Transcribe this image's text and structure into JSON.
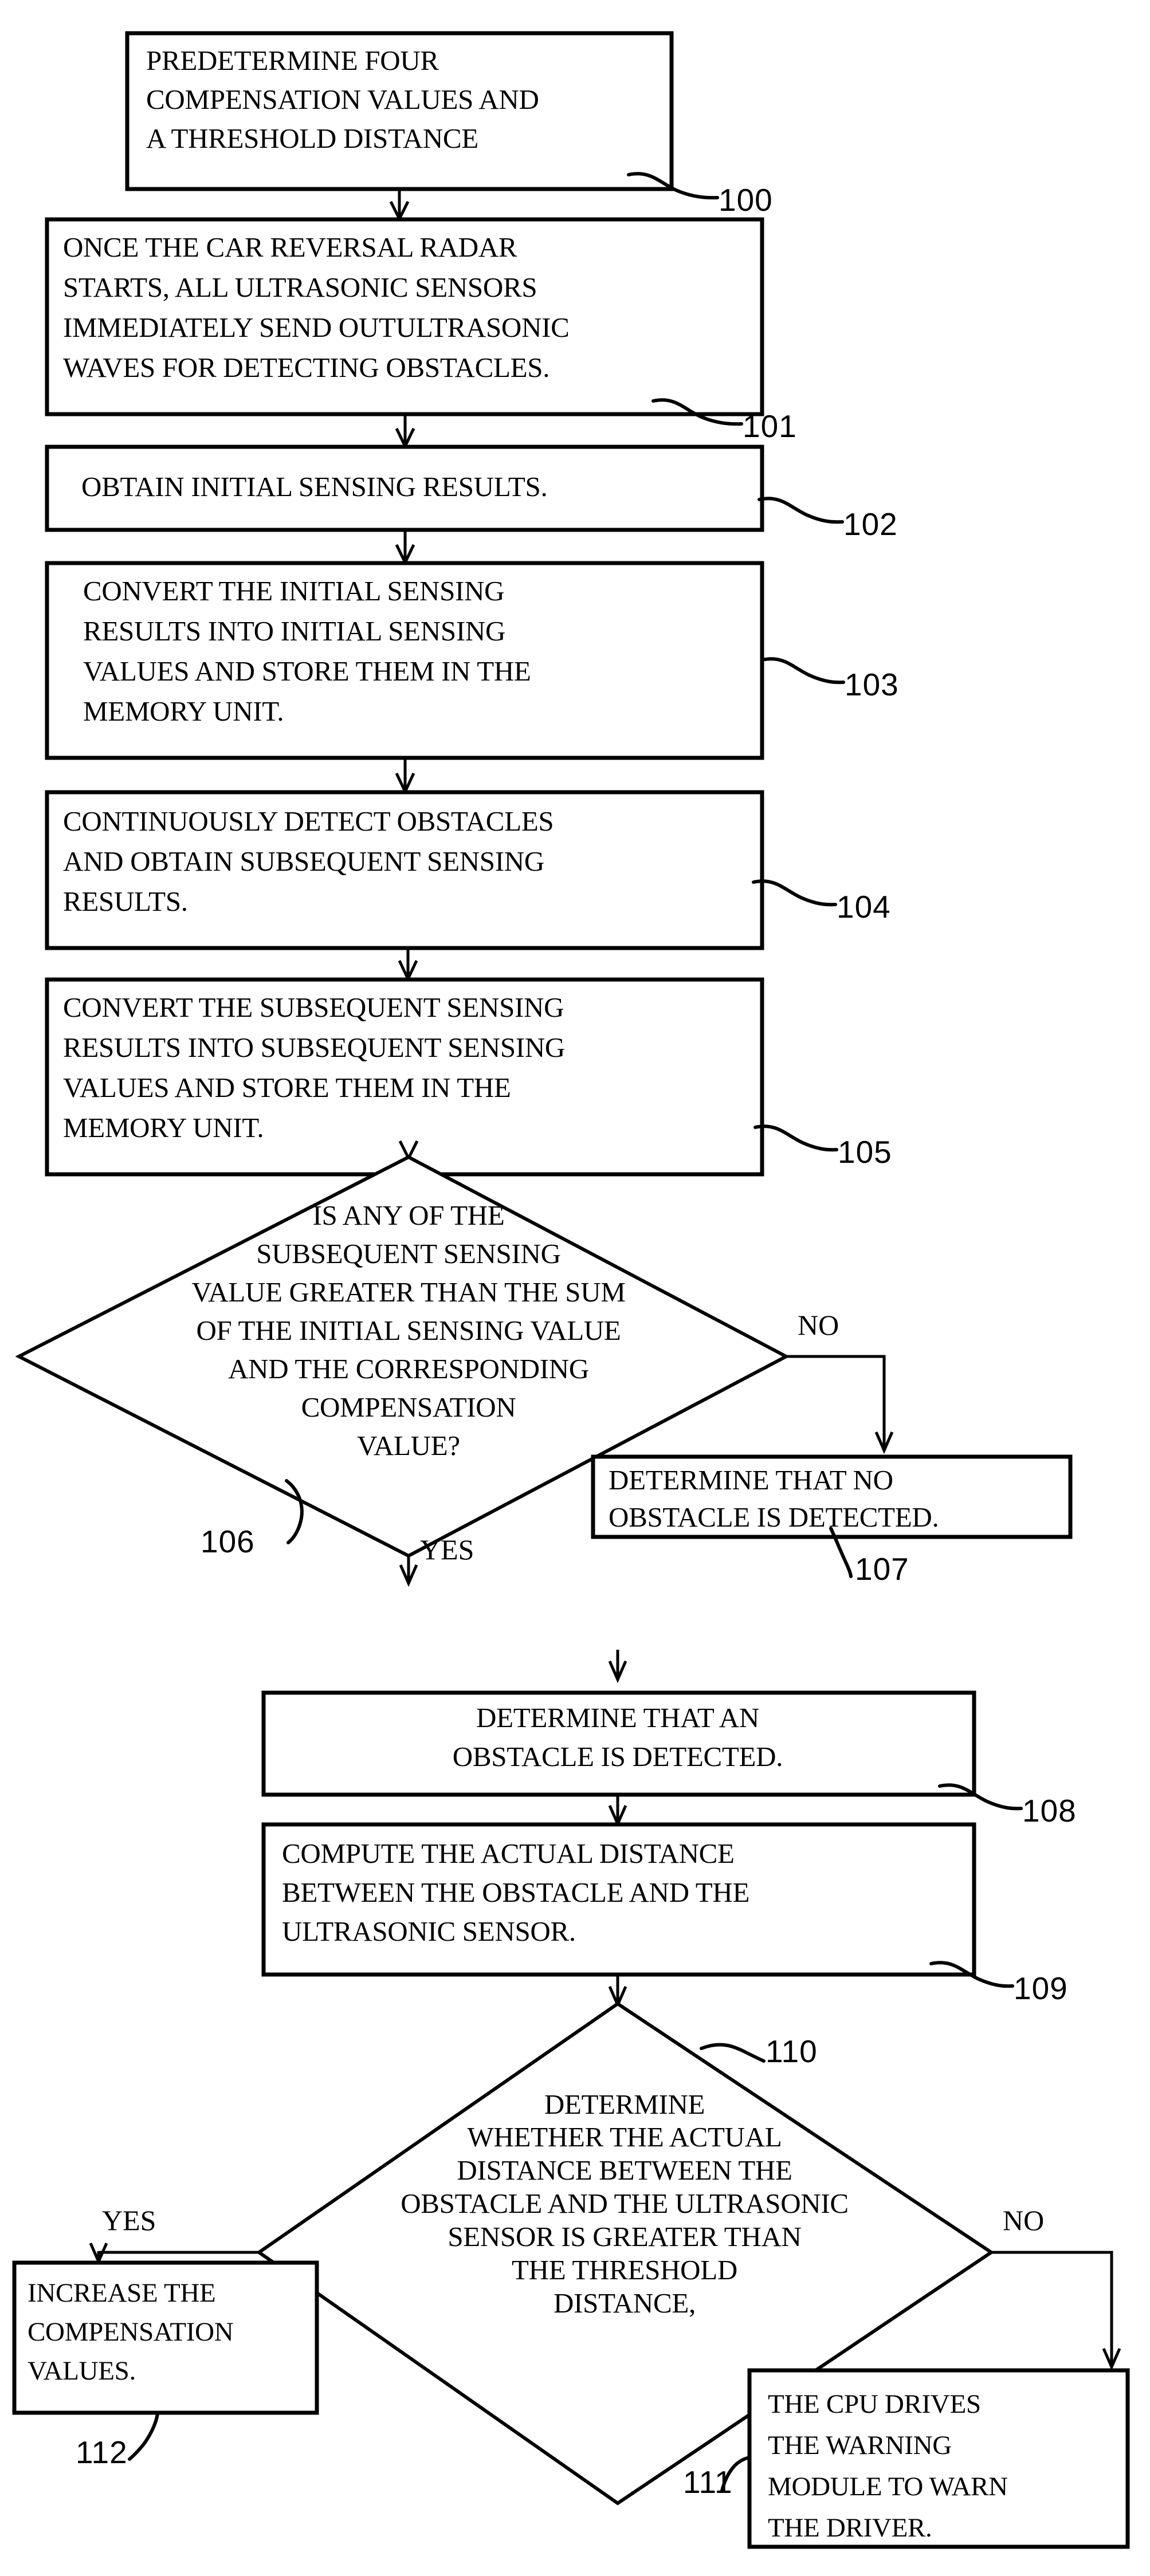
{
  "diagram": {
    "title": "Car reversal radar obstacle detection flowchart",
    "type": "flowchart",
    "stroke_color": "#000000",
    "background_color": "#ffffff"
  },
  "nodes": {
    "n100": {
      "ref": "100",
      "shape": "process",
      "lines": [
        "PREDETERMINE FOUR",
        "COMPENSATION VALUES AND",
        "A THRESHOLD DISTANCE"
      ]
    },
    "n101": {
      "ref": "101",
      "shape": "process",
      "lines": [
        "ONCE THE CAR REVERSAL RADAR",
        "STARTS, ALL ULTRASONIC SENSORS",
        "IMMEDIATELY SEND OUTULTRASONIC",
        "WAVES FOR DETECTING OBSTACLES."
      ]
    },
    "n102": {
      "ref": "102",
      "shape": "process",
      "lines": [
        "OBTAIN INITIAL SENSING RESULTS."
      ]
    },
    "n103": {
      "ref": "103",
      "shape": "process",
      "lines": [
        "CONVERT THE INITIAL SENSING",
        "RESULTS INTO INITIAL SENSING",
        "VALUES AND STORE THEM IN THE",
        "MEMORY UNIT."
      ]
    },
    "n104": {
      "ref": "104",
      "shape": "process",
      "lines": [
        "CONTINUOUSLY DETECT OBSTACLES",
        "AND OBTAIN SUBSEQUENT SENSING",
        "RESULTS."
      ]
    },
    "n105": {
      "ref": "105",
      "shape": "process",
      "lines": [
        "CONVERT THE SUBSEQUENT SENSING",
        "RESULTS INTO SUBSEQUENT SENSING",
        "VALUES AND STORE THEM IN THE",
        "MEMORY UNIT."
      ]
    },
    "n106": {
      "ref": "106",
      "shape": "decision",
      "lines": [
        "IS ANY OF THE",
        "SUBSEQUENT SENSING",
        "VALUE GREATER THAN THE SUM",
        "OF THE INITIAL SENSING VALUE",
        "AND THE CORRESPONDING",
        "COMPENSATION",
        "VALUE?"
      ],
      "branch_yes": "YES",
      "branch_no": "NO"
    },
    "n107": {
      "ref": "107",
      "shape": "process",
      "lines": [
        "DETERMINE THAT NO",
        "OBSTACLE IS DETECTED."
      ]
    },
    "n108": {
      "ref": "108",
      "shape": "process",
      "lines": [
        "DETERMINE THAT AN",
        "OBSTACLE IS DETECTED."
      ]
    },
    "n109": {
      "ref": "109",
      "shape": "process",
      "lines": [
        "COMPUTE THE ACTUAL DISTANCE",
        "BETWEEN THE OBSTACLE AND THE",
        "ULTRASONIC SENSOR."
      ]
    },
    "n110": {
      "ref": "110",
      "shape": "decision",
      "lines": [
        "DETERMINE",
        "WHETHER THE ACTUAL",
        "DISTANCE BETWEEN THE",
        "OBSTACLE AND THE ULTRASONIC",
        "SENSOR IS GREATER THAN",
        "THE THRESHOLD",
        "DISTANCE,"
      ],
      "branch_yes": "YES",
      "branch_no": "NO"
    },
    "n111": {
      "ref": "111",
      "shape": "process",
      "lines": [
        "THE CPU DRIVES",
        "THE WARNING",
        "MODULE TO WARN",
        "THE DRIVER."
      ]
    },
    "n112": {
      "ref": "112",
      "shape": "process",
      "lines": [
        "INCREASE THE",
        "COMPENSATION",
        "VALUES."
      ]
    }
  }
}
